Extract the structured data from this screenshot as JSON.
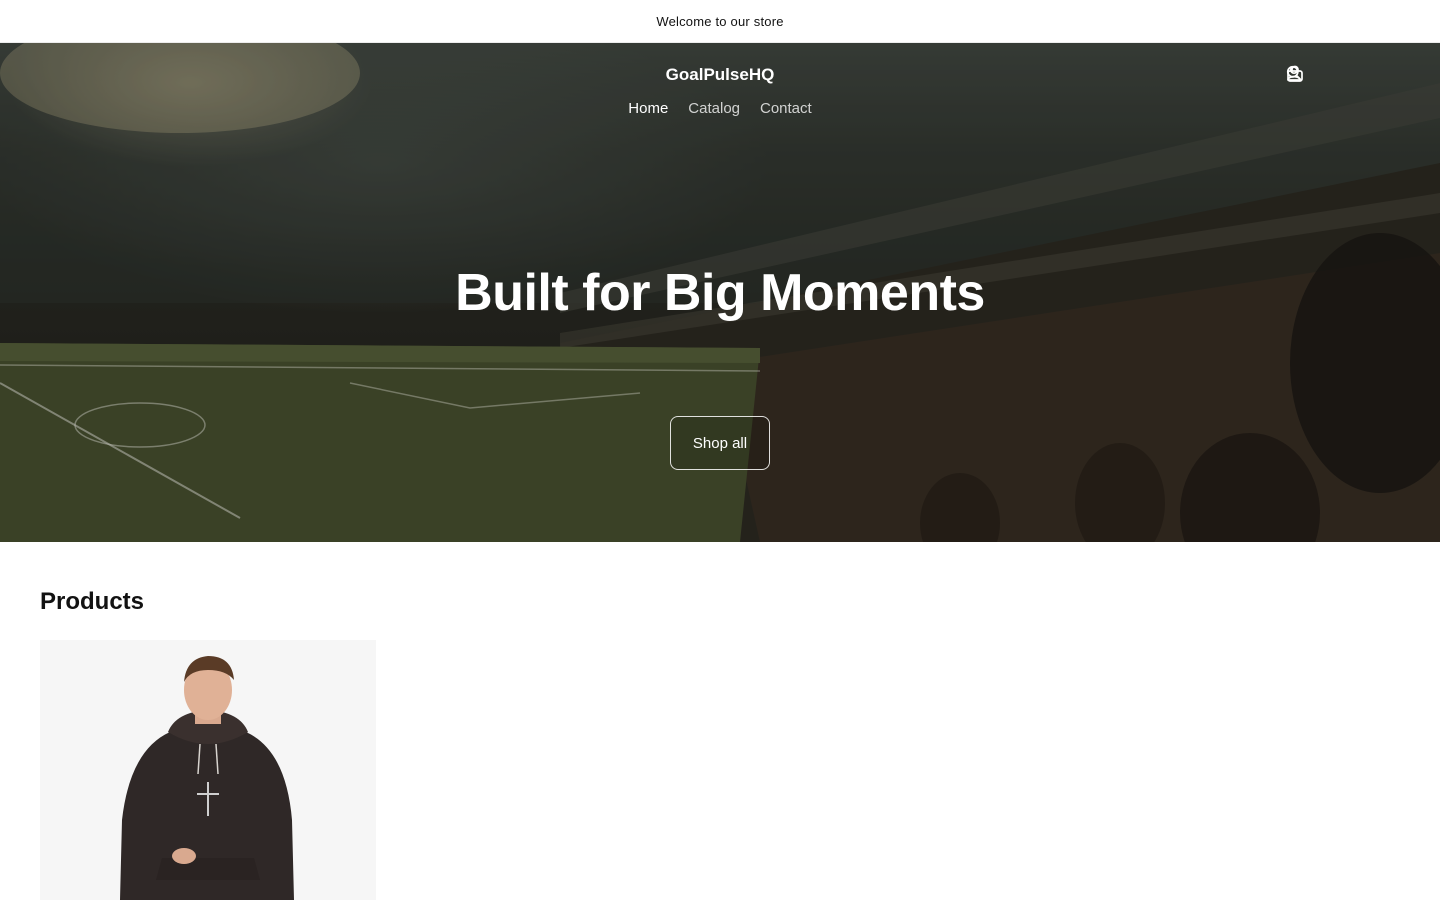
{
  "announcement": {
    "text": "Welcome to our store"
  },
  "header": {
    "logo": "GoalPulseHQ",
    "nav": [
      {
        "label": "Home",
        "active": true
      },
      {
        "label": "Catalog",
        "active": false
      },
      {
        "label": "Contact",
        "active": false
      }
    ],
    "icons": [
      "search-icon",
      "account-icon",
      "cart-icon"
    ]
  },
  "hero": {
    "title": "Built for Big Moments",
    "button_label": "Shop all",
    "image": "stadium-crowd-image"
  },
  "products": {
    "heading": "Products",
    "items": [
      {
        "image": "hoodie-with-cross-image"
      }
    ]
  },
  "colors": {
    "text": "#121212",
    "hero_text": "#ffffff",
    "card_background": "#f6f6f6"
  }
}
